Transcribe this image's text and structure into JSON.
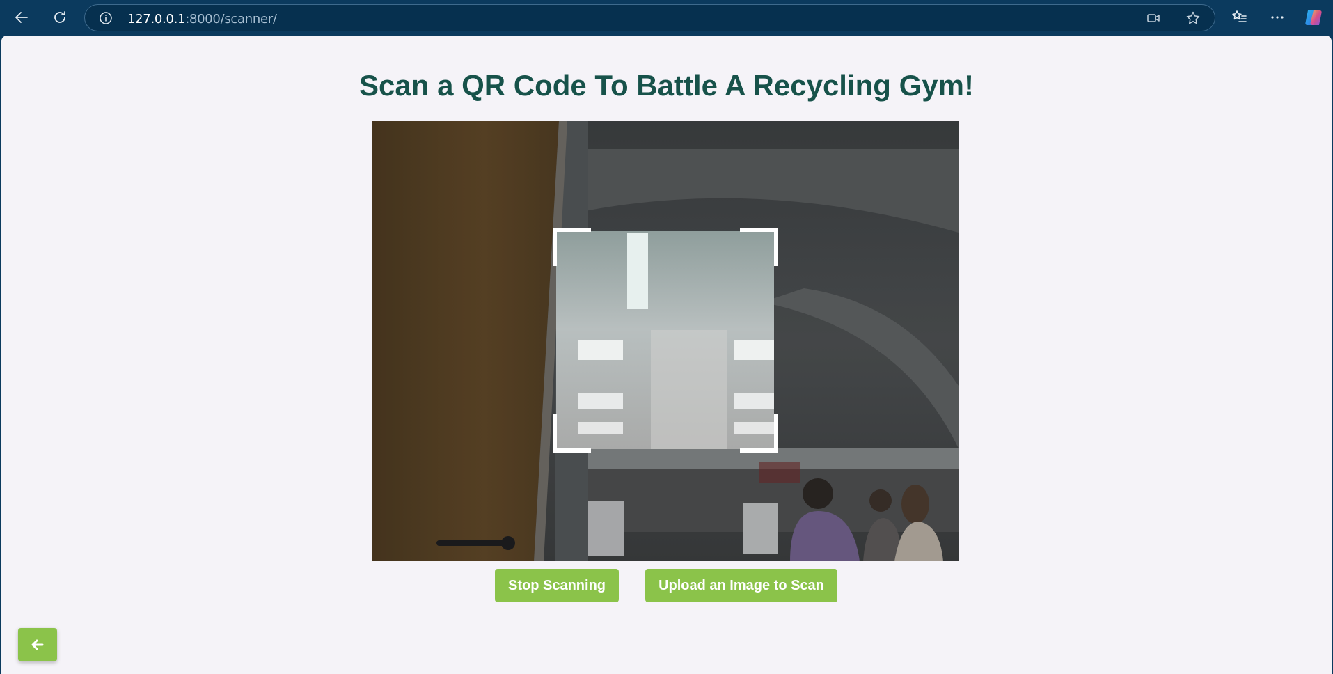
{
  "browser": {
    "url_host": "127.0.0.1",
    "url_rest": ":8000/scanner/",
    "icons": [
      "back-arrow-icon",
      "refresh-icon",
      "site-info-icon",
      "camera-in-use-icon",
      "favorite-star-icon",
      "favorites-list-icon",
      "more-options-icon",
      "copilot-icon"
    ]
  },
  "page": {
    "title": "Scan a QR Code To Battle A Recycling Gym!",
    "stop_button": "Stop Scanning",
    "upload_button": "Upload an Image to Scan",
    "back_icon": "arrow-left-icon"
  },
  "colors": {
    "chrome": "#0b3a5e",
    "page_bg": "#f5f3f8",
    "title": "#17524a",
    "accent_green": "#8bc34a"
  }
}
